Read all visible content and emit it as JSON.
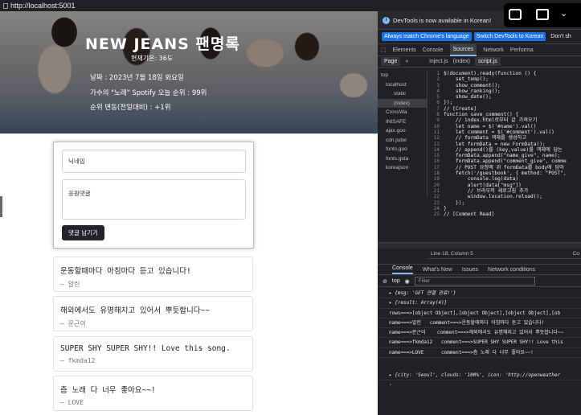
{
  "browser": {
    "url": "http://localhost:5001"
  },
  "banner": {
    "title": "NEW JEANS 팬명록",
    "temperature": "현재기온: 36도",
    "date": "날짜 : 2023년 7월 18일 화요일",
    "ranking": "가수의 \"노래\" Spotify 오늘 순위 : 99위",
    "change": "순위 변동(전일대비) : +1위"
  },
  "form": {
    "name_placeholder": "닉네임",
    "comment_placeholder": "응원댓글",
    "submit_label": "댓글 남기기"
  },
  "comments": [
    {
      "text": "운동할때마다 아침마다 듣고 있습니다!",
      "author": "– 알린"
    },
    {
      "text": "해외에서도 유명해지고 있어서 뿌듯합니다~~",
      "author": "– 문근이"
    },
    {
      "text": "SUPER SHY SUPER SHY!! Love this song.",
      "author": "– fkmda12"
    },
    {
      "text": "츰 노래 다 너무 좋아요~~!",
      "author": "– LOVE"
    }
  ],
  "devtools": {
    "notice": "DevTools is now available in Korean!",
    "btn_match": "Always match Chrome's language",
    "btn_switch": "Switch DevTools to Korean",
    "btn_dont": "Don't sh",
    "main_tabs": [
      "Elements",
      "Console",
      "Sources",
      "Network",
      "Performa"
    ],
    "file_tabs": {
      "page": "Page",
      "more": "»",
      "f1": "inject.js",
      "f2": "(index)",
      "f3": "script.js"
    },
    "nav": [
      "top",
      "localhost",
      "static",
      "(index)",
      "CrossWa",
      "INISAFE",
      "ajax.goo",
      "cdn.jsdel",
      "fonts.goo",
      "fonts.gsta",
      "koreajson"
    ],
    "code": [
      {
        "n": "1",
        "t": "$(document).ready(function () {"
      },
      {
        "n": "2",
        "t": "    set_temp();"
      },
      {
        "n": "3",
        "t": "    show_comment();"
      },
      {
        "n": "4",
        "t": "    show_ranking();"
      },
      {
        "n": "5",
        "t": "    show_date();"
      },
      {
        "n": "6",
        "t": "});"
      },
      {
        "n": "7",
        "t": "// [Create]"
      },
      {
        "n": "8",
        "t": "function save_comment() {"
      },
      {
        "n": "9",
        "t": "    // index.html로부터 값 가져오기"
      },
      {
        "n": "10",
        "t": "    let name = $('#name').val()"
      },
      {
        "n": "11",
        "t": "    let comment = $('#comment').val()"
      },
      {
        "n": "12",
        "t": "    // formData 객체를 생성하고"
      },
      {
        "n": "13",
        "t": "    let formData = new FormData();"
      },
      {
        "n": "14",
        "t": "    // append()를 (key,value)를 객체에 담는"
      },
      {
        "n": "15",
        "t": "    formData.append(\"name_give\", name);"
      },
      {
        "n": "16",
        "t": "    formData.append(\"comment_give\", comme"
      },
      {
        "n": "17",
        "t": "    // POST 요청에 위 formData를 body에 담아"
      },
      {
        "n": "18",
        "t": "    fetch('/guestbook', { method: \"POST\","
      },
      {
        "n": "19",
        "t": "        console.log(data)"
      },
      {
        "n": "20",
        "t": "        alert(data[\"msg\"])"
      },
      {
        "n": "21",
        "t": "        // 브라우저 새로고침 추가"
      },
      {
        "n": "22",
        "t": "        window.location.reload();"
      },
      {
        "n": "23",
        "t": "    });"
      },
      {
        "n": "24",
        "t": "}"
      },
      {
        "n": "25",
        "t": "// [Comment Read]"
      }
    ],
    "status": "Line 18, Column 5",
    "status_right": "Co",
    "console_tabs": [
      "Console",
      "What's New",
      "Issues",
      "Network conditions"
    ],
    "context": "top",
    "filter_placeholder": "Filter",
    "log": [
      "▸ {msg: 'GET 연결 완료!'}",
      "▸ {result: Array(4)}",
      "rows===>[object Object],[object Object],[object Object],[ob",
      "name===>알린   comment===>운동할때마다 아침마다 듣고 있습니다!",
      "name===>문근이    comment===>해외에서도 유명해지고 있어서 뿌듯합니다~~",
      "name===>fkmda12   comment===>SUPER SHY SUPER SHY!! Love this",
      "name===>LOVE      comment===>츰 노래 다 너무 좋아요~~!",
      "▸ {city: 'Seoul', clouds: '100%', icon: 'http://openweather"
    ]
  }
}
